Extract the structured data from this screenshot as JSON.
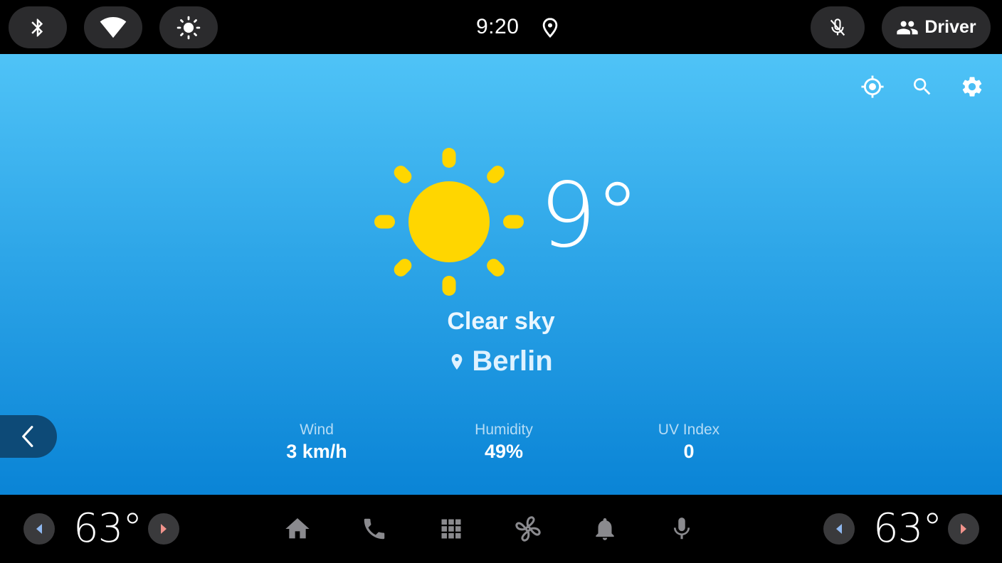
{
  "status_bar": {
    "time": "9:20",
    "icons": [
      "bluetooth-icon",
      "wifi-icon",
      "brightness-icon",
      "location-icon",
      "mic-off-icon"
    ],
    "profile_label": "Driver"
  },
  "weather": {
    "temperature": "9°",
    "condition": "Clear sky",
    "city": "Berlin",
    "metrics": [
      {
        "label": "Wind",
        "value": "3 km/h"
      },
      {
        "label": "Humidity",
        "value": "49%"
      },
      {
        "label": "UV Index",
        "value": "0"
      }
    ],
    "actions": [
      "my-location-icon",
      "search-icon",
      "settings-icon"
    ]
  },
  "nav_bar": {
    "left_temp": "63°",
    "right_temp": "63°",
    "icons": [
      "home-icon",
      "phone-icon",
      "apps-grid-icon",
      "fan-icon",
      "notifications-icon",
      "microphone-icon"
    ]
  },
  "colors": {
    "sky_top": "#4fc3f7",
    "sky_bottom": "#0a84d6",
    "sun": "#ffd600",
    "pill_bg": "#2b2b2d",
    "back_button": "#0d4a77"
  }
}
